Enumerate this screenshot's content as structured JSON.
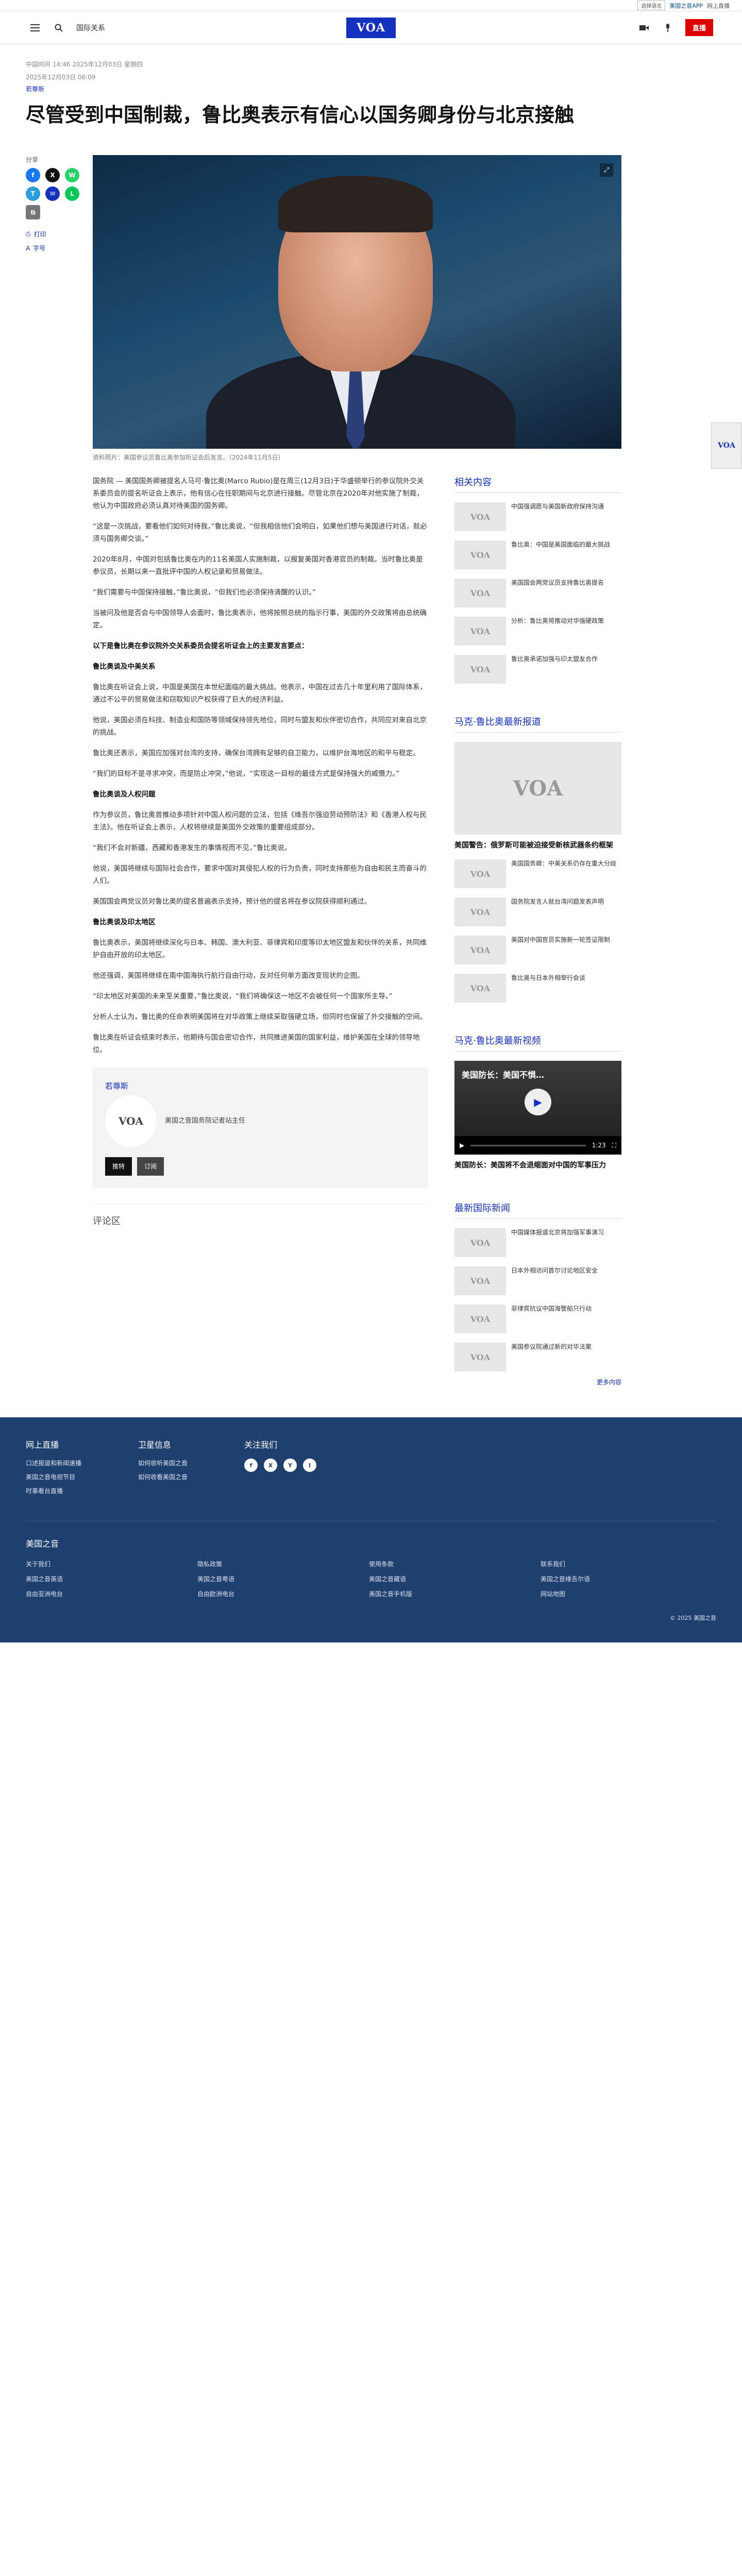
{
  "utility_bar": {
    "language_select": "选择语言",
    "app_link": "美国之音APP",
    "extra_link": "网上直播"
  },
  "header": {
    "section_name": "国际关系",
    "logo_text": "VOA",
    "live_label": "直播"
  },
  "article": {
    "meta_top": "中国时间 14:46 2025年12月03日 星期四",
    "updated": "2025年12月03日 06:09",
    "byline": "若尊斯",
    "title": "尽管受到中国制裁，鲁比奥表示有信心以国务卿身份与北京接触",
    "hero_caption": "资料照片：美国参议员鲁比奥参加听证会后发言。（2024年11月5日）",
    "paragraphs": [
      {
        "text": "国务院 — 美国国务卿被提名人马可·鲁比奥(Marco Rubio)是在周三(12月3日)于华盛顿举行的参议院外交关系委员会的提名听证会上表示，他有信心在任职期间与北京进行接触。尽管北京在2020年对他实施了制裁，他认为中国政府必须认真对待美国的国务卿。",
        "sub": false
      },
      {
        "text": "“这是一次挑战，要看他们如何对待我，”鲁比奥说，“但我相信他们会明白，如果他们想与美国进行对话，就必须与国务卿交谈。”",
        "sub": false
      },
      {
        "text": "2020年8月，中国对包括鲁比奥在内的11名美国人实施制裁，以报复美国对香港官员的制裁。当时鲁比奥是参议员，长期以来一直批评中国的人权记录和贸易做法。",
        "sub": false
      },
      {
        "text": "“我们需要与中国保持接触，”鲁比奥说，“但我们也必须保持清醒的认识。”",
        "sub": false
      },
      {
        "text": "当被问及他是否会与中国领导人会面时，鲁比奥表示，他将按照总统的指示行事，美国的外交政策将由总统确定。",
        "sub": false
      },
      {
        "text": "以下是鲁比奥在参议院外交关系委员会提名听证会上的主要发言要点：",
        "sub": true
      },
      {
        "text": "鲁比奥谈及中美关系",
        "sub": true
      },
      {
        "text": "鲁比奥在听证会上说，中国是美国在本世纪面临的最大挑战。他表示，中国在过去几十年里利用了国际体系，通过不公平的贸易做法和窃取知识产权获得了巨大的经济利益。",
        "sub": false
      },
      {
        "text": "他说，美国必须在科技、制造业和国防等领域保持领先地位，同时与盟友和伙伴密切合作，共同应对来自北京的挑战。",
        "sub": false
      },
      {
        "text": "鲁比奥还表示，美国应加强对台湾的支持，确保台湾拥有足够的自卫能力，以维护台海地区的和平与稳定。",
        "sub": false
      },
      {
        "text": "“我们的目标不是寻求冲突，而是防止冲突，”他说，“实现这一目标的最佳方式是保持强大的威慑力。”",
        "sub": false
      },
      {
        "text": "鲁比奥谈及人权问题",
        "sub": true
      },
      {
        "text": "作为参议员，鲁比奥曾推动多项针对中国人权问题的立法，包括《维吾尔强迫劳动预防法》和《香港人权与民主法》。他在听证会上表示，人权将继续是美国外交政策的重要组成部分。",
        "sub": false
      },
      {
        "text": "“我们不会对新疆、西藏和香港发生的事情视而不见，”鲁比奥说。",
        "sub": false
      },
      {
        "text": "他说，美国将继续与国际社会合作，要求中国对其侵犯人权的行为负责，同时支持那些为自由和民主而奋斗的人们。",
        "sub": false
      },
      {
        "text": "美国国会两党议员对鲁比奥的提名普遍表示支持，预计他的提名将在参议院获得顺利通过。",
        "sub": false
      },
      {
        "text": "鲁比奥谈及印太地区",
        "sub": true
      },
      {
        "text": "鲁比奥表示，美国将继续深化与日本、韩国、澳大利亚、菲律宾和印度等印太地区盟友和伙伴的关系，共同维护自由开放的印太地区。",
        "sub": false
      },
      {
        "text": "他还强调，美国将继续在南中国海执行航行自由行动，反对任何单方面改变现状的企图。",
        "sub": false
      },
      {
        "text": "“印太地区对美国的未来至关重要，”鲁比奥说，“我们将确保这一地区不会被任何一个国家所主导。”",
        "sub": false
      },
      {
        "text": "分析人士认为，鲁比奥的任命表明美国将在对华政策上继续采取强硬立场，但同时也保留了外交接触的空间。",
        "sub": false
      },
      {
        "text": "鲁比奥在听证会结束时表示，他期待与国会密切合作，共同推进美国的国家利益，维护美国在全球的领导地位。",
        "sub": false
      }
    ],
    "author": {
      "name": "若尊斯",
      "avatar_text": "VOA",
      "description": "美国之音国务院记者站主任",
      "x_button": "推特",
      "mail_button": "订阅"
    },
    "comments_title": "评论区"
  },
  "share": {
    "label": "分享",
    "buttons": [
      "f",
      "X",
      "W",
      "T",
      "✉",
      "L",
      "⧉"
    ],
    "print_label": "打印",
    "font_label": "字号"
  },
  "sidebar": {
    "related_title": "相关内容",
    "related": [
      "中国强调愿与美国新政府保持沟通",
      "鲁比奥：中国是美国面临的最大挑战",
      "美国国会两党议员支持鲁比奥提名",
      "分析：鲁比奥将推动对华强硬政策",
      "鲁比奥承诺加强与印太盟友合作"
    ],
    "latest_title": "马克·鲁比奥最新报道",
    "latest_feature": "美国警告：俄罗斯可能被迫接受新核武器条约框架",
    "latest": [
      "美国国务卿：中美关系仍存在重大分歧",
      "国务院发言人就台湾问题发表声明",
      "美国对中国官员实施新一轮签证限制",
      "鲁比奥与日本外相举行会谈"
    ],
    "video_title": "马克·鲁比奥最新视频",
    "video": {
      "overlay_title": "美国防长：美国不惧…",
      "duration": "1:23",
      "caption": "美国防长：美国将不会退缩面对中国的军事压力"
    },
    "intl_title": "最新国际新闻",
    "intl": [
      "中国媒体报道北京将加强军事演习",
      "日本外相访问首尔讨论地区安全",
      "菲律宾抗议中国海警船只行动",
      "美国参议院通过新的对华法案"
    ],
    "more_label": "更多内容"
  },
  "float_badge": "VOA",
  "footer": {
    "col1_title": "网上直播",
    "col1_items": [
      "口述报道和新闻速播",
      "美国之音电视节目",
      "时事看台直播"
    ],
    "col2_title": "卫星信息",
    "col2_items": [
      "如何收听美国之音",
      "如何收看美国之音"
    ],
    "col3_title": "关注我们",
    "social": [
      "f",
      "X",
      "Y",
      "I"
    ],
    "sites_title": "美国之音",
    "sites": [
      "关于我们",
      "隐私政策",
      "使用条款",
      "联系我们",
      "美国之音英语",
      "美国之音粤语",
      "美国之音藏语",
      "美国之音维吾尔语",
      "自由亚洲电台",
      "自由欧洲电台",
      "美国之音手机版",
      "网站地图"
    ],
    "copyright": "© 2025 美国之音"
  }
}
